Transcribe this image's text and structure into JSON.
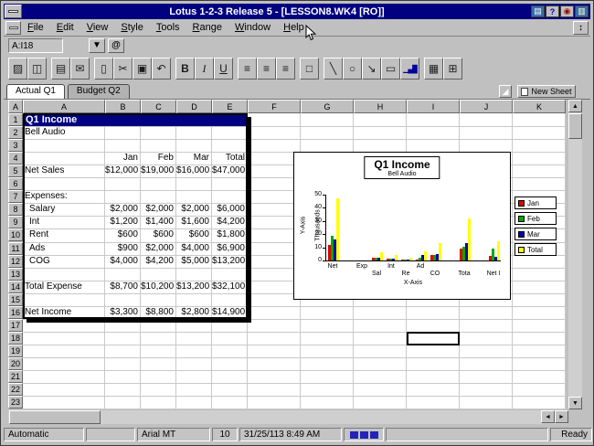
{
  "window": {
    "title": "Lotus 1-2-3 Release 5 - [LESSON8.WK4 [RO]]",
    "utility_icons": [
      {
        "name": "window-utility-icon",
        "glyph": "▤"
      },
      {
        "name": "help-utility-icon",
        "glyph": "?"
      },
      {
        "name": "record-utility-icon",
        "glyph": "◉"
      },
      {
        "name": "layers-utility-icon",
        "glyph": "▥"
      }
    ]
  },
  "icons": {
    "mdi_restore": "↕",
    "tab_splitter": "◢",
    "scroll_up": "▲",
    "scroll_down": "▼",
    "scroll_left": "◄",
    "scroll_right": "►"
  },
  "menu_bar": {
    "items": [
      "File",
      "Edit",
      "View",
      "Style",
      "Tools",
      "Range",
      "Window",
      "Help"
    ]
  },
  "edit_line": {
    "cell_ref": "A:I18",
    "navigator_glyph": "▼",
    "function_glyph": "@"
  },
  "toolbar": {
    "groups": [
      [
        {
          "name": "open-file",
          "glyph": "▨"
        },
        {
          "name": "save-file",
          "glyph": "◫"
        }
      ],
      [
        {
          "name": "print",
          "glyph": "▤"
        },
        {
          "name": "send-mail",
          "glyph": "✉"
        }
      ],
      [
        {
          "name": "paste",
          "glyph": "▯"
        },
        {
          "name": "cut",
          "glyph": "✂"
        },
        {
          "name": "copy",
          "glyph": "▣"
        },
        {
          "name": "undo",
          "glyph": "↶"
        }
      ],
      [
        {
          "name": "bold",
          "glyph": "B",
          "style": "b"
        },
        {
          "name": "italic",
          "glyph": "I",
          "style": "i"
        },
        {
          "name": "underline",
          "glyph": "U",
          "style": "u"
        }
      ],
      [
        {
          "name": "align-left",
          "glyph": "≡"
        },
        {
          "name": "align-center",
          "glyph": "≡"
        },
        {
          "name": "align-right",
          "glyph": "≡"
        }
      ],
      [
        {
          "name": "select-range",
          "glyph": "□"
        }
      ],
      [
        {
          "name": "draw-line",
          "glyph": "╲"
        },
        {
          "name": "draw-ellipse",
          "glyph": "○"
        },
        {
          "name": "draw-arrow",
          "glyph": "↘"
        },
        {
          "name": "draw-button",
          "glyph": "▭"
        },
        {
          "name": "chart-tool",
          "glyph": "▁▄█",
          "style": "sm"
        }
      ],
      [
        {
          "name": "grid-tool",
          "glyph": "▦"
        },
        {
          "name": "smarticons",
          "glyph": "⊞"
        }
      ]
    ]
  },
  "tab_bar": {
    "tabs": [
      {
        "label": "Actual Q1",
        "active": true
      },
      {
        "label": "Budget Q2",
        "active": false
      }
    ],
    "new_sheet_label": "New Sheet"
  },
  "sheet": {
    "corner_label": "A",
    "columns": [
      "A",
      "B",
      "C",
      "D",
      "E",
      "F",
      "G",
      "H",
      "I",
      "J",
      "K"
    ],
    "row_count": 23,
    "selection": "I18",
    "title_cell": {
      "text": "Q1 Income",
      "range": "A1:E1"
    },
    "table_frame_range": "A1:E16",
    "cells": [
      [
        "A",
        2,
        "Bell Audio",
        "l"
      ],
      [
        "B",
        4,
        "Jan",
        "r"
      ],
      [
        "C",
        4,
        "Feb",
        "r"
      ],
      [
        "D",
        4,
        "Mar",
        "r"
      ],
      [
        "E",
        4,
        "Total",
        "r"
      ],
      [
        "A",
        5,
        "Net Sales",
        "l"
      ],
      [
        "B",
        5,
        "$12,000",
        "r"
      ],
      [
        "C",
        5,
        "$19,000",
        "r"
      ],
      [
        "D",
        5,
        "$16,000",
        "r"
      ],
      [
        "E",
        5,
        "$47,000",
        "r"
      ],
      [
        "A",
        7,
        "Expenses:",
        "l"
      ],
      [
        "A",
        8,
        "Salary",
        "li"
      ],
      [
        "B",
        8,
        "$2,000",
        "r"
      ],
      [
        "C",
        8,
        "$2,000",
        "r"
      ],
      [
        "D",
        8,
        "$2,000",
        "r"
      ],
      [
        "E",
        8,
        "$6,000",
        "r"
      ],
      [
        "A",
        9,
        "Int",
        "li"
      ],
      [
        "B",
        9,
        "$1,200",
        "r"
      ],
      [
        "C",
        9,
        "$1,400",
        "r"
      ],
      [
        "D",
        9,
        "$1,600",
        "r"
      ],
      [
        "E",
        9,
        "$4,200",
        "r"
      ],
      [
        "A",
        10,
        "Rent",
        "li"
      ],
      [
        "B",
        10,
        "$600",
        "r"
      ],
      [
        "C",
        10,
        "$600",
        "r"
      ],
      [
        "D",
        10,
        "$600",
        "r"
      ],
      [
        "E",
        10,
        "$1,800",
        "r"
      ],
      [
        "A",
        11,
        "Ads",
        "li"
      ],
      [
        "B",
        11,
        "$900",
        "r"
      ],
      [
        "C",
        11,
        "$2,000",
        "r"
      ],
      [
        "D",
        11,
        "$4,000",
        "r"
      ],
      [
        "E",
        11,
        "$6,900",
        "r"
      ],
      [
        "A",
        12,
        "COG",
        "li"
      ],
      [
        "B",
        12,
        "$4,000",
        "r"
      ],
      [
        "C",
        12,
        "$4,200",
        "r"
      ],
      [
        "D",
        12,
        "$5,000",
        "r"
      ],
      [
        "E",
        12,
        "$13,200",
        "r"
      ],
      [
        "A",
        14,
        "Total Expense",
        "l"
      ],
      [
        "B",
        14,
        "$8,700",
        "r"
      ],
      [
        "C",
        14,
        "$10,200",
        "r"
      ],
      [
        "D",
        14,
        "$13,200",
        "r"
      ],
      [
        "E",
        14,
        "$32,100",
        "r"
      ],
      [
        "A",
        16,
        "Net Income",
        "l"
      ],
      [
        "B",
        16,
        "$3,300",
        "r"
      ],
      [
        "C",
        16,
        "$8,800",
        "r"
      ],
      [
        "D",
        16,
        "$2,800",
        "r"
      ],
      [
        "E",
        16,
        "$14,900",
        "r"
      ]
    ]
  },
  "chart_data": {
    "type": "bar",
    "title": "Q1 Income",
    "subtitle": "Bell Audio",
    "xlabel": "X-Axis",
    "ylabel": "Y-Axis",
    "y_units": "Thousands",
    "ylim": [
      0,
      50
    ],
    "yticks": [
      0,
      10,
      20,
      30,
      40,
      50
    ],
    "grid": false,
    "legend_position": "right",
    "categories_full": [
      "Net Sales",
      "",
      "Expenses",
      "Salary",
      "Int",
      "Rent",
      "Ads",
      "COG",
      "",
      "Total Expense",
      "",
      "Net Income"
    ],
    "categories_display": [
      "Net",
      "",
      "Exp",
      "Sal",
      "Int",
      "Re",
      "Ad",
      "CO",
      "",
      "Tota",
      "",
      "Net I"
    ],
    "label_row": [
      "top",
      "bottom",
      "top",
      "bottom",
      "top",
      "bottom",
      "top",
      "bottom",
      "top",
      "bottom",
      "top",
      "bottom"
    ],
    "series": [
      {
        "name": "Jan",
        "color": "#dd0000",
        "values": [
          12,
          null,
          null,
          2,
          1.2,
          0.6,
          0.9,
          4,
          null,
          8.7,
          null,
          3.3
        ]
      },
      {
        "name": "Feb",
        "color": "#00a800",
        "values": [
          19,
          null,
          null,
          2,
          1.4,
          0.6,
          2,
          4.2,
          null,
          10.2,
          null,
          8.8
        ]
      },
      {
        "name": "Mar",
        "color": "#0000b4",
        "values": [
          16,
          null,
          null,
          2,
          1.6,
          0.6,
          4,
          5,
          null,
          13.2,
          null,
          2.8
        ]
      },
      {
        "name": "Total",
        "color": "#ffff00",
        "values": [
          47,
          null,
          null,
          6,
          4.2,
          1.8,
          6.9,
          13.2,
          null,
          32.1,
          null,
          14.9
        ]
      }
    ]
  },
  "status_bar": {
    "recalc": "Automatic",
    "font_name": "Arial MT",
    "font_size": "10",
    "datetime": "31/25/113 8:49 AM",
    "ready": "Ready"
  }
}
